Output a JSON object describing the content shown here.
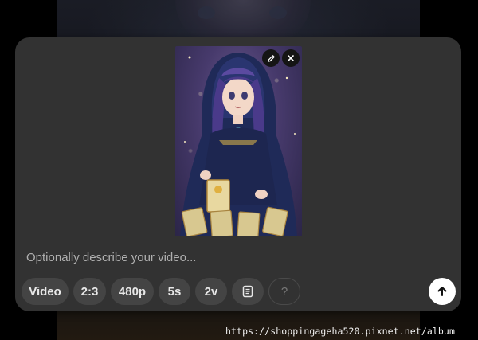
{
  "composer": {
    "prompt_placeholder": "Optionally describe your video..."
  },
  "attachment": {
    "edit_icon": "pencil-icon",
    "remove_icon": "close-icon"
  },
  "options": {
    "mode": "Video",
    "aspect_ratio": "2:3",
    "resolution": "480p",
    "duration": "5s",
    "variants": "2v",
    "prompt_icon": "document-icon",
    "help": "?"
  },
  "submit_icon": "arrow-up-icon",
  "watermark": "https://shoppingageha520.pixnet.net/album",
  "colors": {
    "card": "#323232",
    "chip": "#444444",
    "submit": "#ffffff"
  }
}
